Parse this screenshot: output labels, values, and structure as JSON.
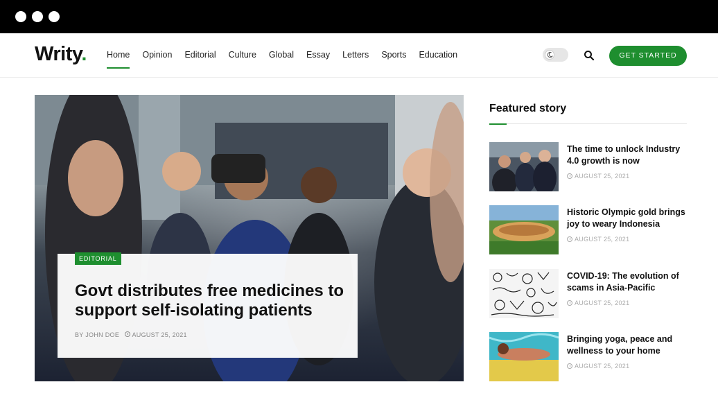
{
  "window": {
    "controls": [
      "close",
      "minimize",
      "maximize"
    ]
  },
  "header": {
    "logo": "Writy",
    "logo_dot": ".",
    "nav": [
      {
        "label": "Home",
        "active": true
      },
      {
        "label": "Opinion",
        "active": false
      },
      {
        "label": "Editorial",
        "active": false
      },
      {
        "label": "Culture",
        "active": false
      },
      {
        "label": "Global",
        "active": false
      },
      {
        "label": "Essay",
        "active": false
      },
      {
        "label": "Letters",
        "active": false
      },
      {
        "label": "Sports",
        "active": false
      },
      {
        "label": "Education",
        "active": false
      }
    ],
    "theme_toggle_icon": "moon-icon",
    "search_icon": "search-icon",
    "cta_label": "GET STARTED"
  },
  "hero": {
    "image": "people-applauding-vr-headset-photo",
    "category": "EDITORIAL",
    "headline": "Govt distributes free medicines to support self-isolating patients",
    "author": "BY JOHN DOE",
    "date": "AUGUST 25, 2021"
  },
  "sidebar": {
    "title": "Featured story",
    "stories": [
      {
        "image": "business-meeting-photo",
        "title": "The time to unlock Industry 4.0 growth is now",
        "date": "AUGUST 25, 2021"
      },
      {
        "image": "stadium-aerial-photo",
        "title": "Historic Olympic gold brings joy to weary Indonesia",
        "date": "AUGUST 25, 2021"
      },
      {
        "image": "doodle-pattern-photo",
        "title": "COVID-19: The evolution of scams in Asia-Pacific",
        "date": "AUGUST 25, 2021"
      },
      {
        "image": "swimmer-underwater-photo",
        "title": "Bringing yoga, peace and wellness to your home",
        "date": "AUGUST 25, 2021"
      }
    ]
  },
  "colors": {
    "accent": "#1e8e2f",
    "chrome": "#000000"
  }
}
